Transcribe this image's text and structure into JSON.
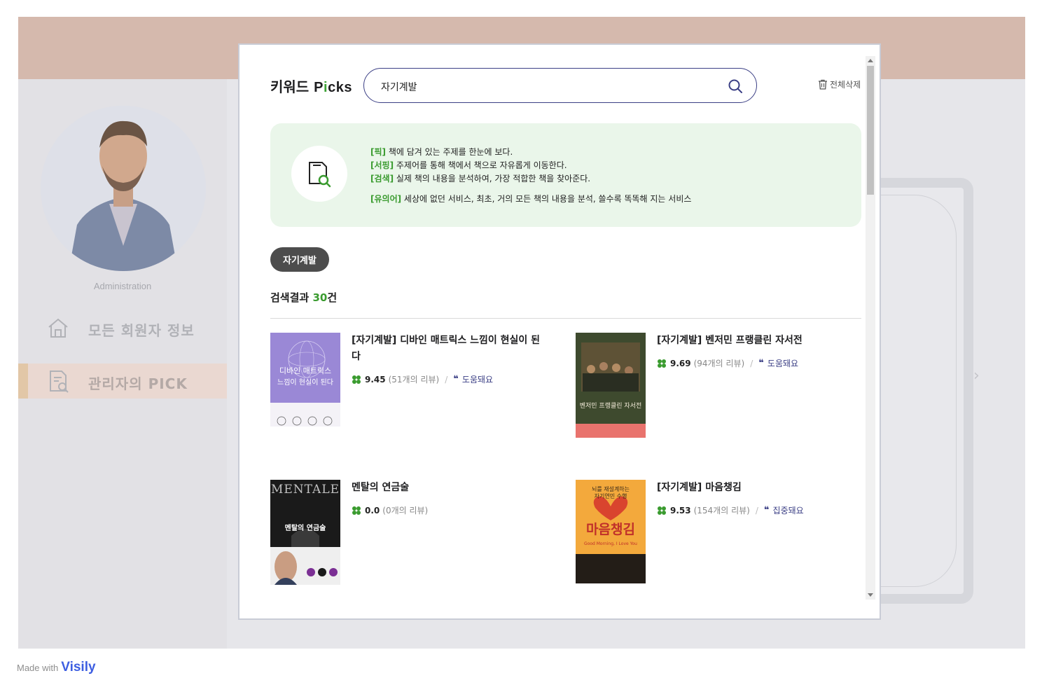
{
  "sidebar": {
    "admin_label": "Administration",
    "items": [
      {
        "label": "모든 회원자 정보",
        "icon": "home-icon"
      },
      {
        "label": "관리자의 PICK",
        "icon": "document-search-icon"
      }
    ]
  },
  "modal": {
    "logo": {
      "prefix": "키워드",
      "brand_p": "P",
      "brand_i": "i",
      "brand_rest": "cks"
    },
    "search": {
      "value": "자기계발",
      "icon": "search-icon"
    },
    "clear_all": "전체삭제",
    "info": {
      "lines": [
        {
          "tag": "[픽]",
          "text": " 책에 담겨 있는 주제를 한눈에 보다."
        },
        {
          "tag": "[서핑]",
          "text": " 주제어를 통해 책에서 책으로 자유롭게 이동한다."
        },
        {
          "tag": "[검색]",
          "text": " 실제 책의 내용을 분석하여, 가장 적합한 책을 찾아준다."
        },
        {
          "tag": "[유의어]",
          "text": " 세상에 없던 서비스, 최초, 거의 모든 책의 내용을 분석, 쓸수록 똑똑해 지는 서비스"
        }
      ]
    },
    "chip": "자기계발",
    "results": {
      "prefix": "검색결과 ",
      "count": "30",
      "suffix": "건"
    },
    "books": [
      {
        "title": "[자기계발] 디바인 매트릭스 느낌이 현실이 된다",
        "score": "9.45",
        "reviews": "(51개의 리뷰)",
        "tag": "도움돼요",
        "cover": {
          "line1": "디바인 매트릭스",
          "line2": "느낌이 현실이 된다"
        }
      },
      {
        "title": "[자기계발] 벤저민 프랭클린 자서전",
        "score": "9.69",
        "reviews": "(94개의 리뷰)",
        "tag": "도움돼요",
        "cover": {
          "line1": "벤저민 프랭클린 자서전"
        }
      },
      {
        "title": "멘탈의 연금술",
        "score": "0.0",
        "reviews": "(0개의 리뷰)",
        "tag": "",
        "cover": {
          "line0": "MENTALE",
          "line1": "멘탈의 연금술"
        }
      },
      {
        "title": "[자기계발] 마음챙김",
        "score": "9.53",
        "reviews": "(154개의 리뷰)",
        "tag": "집중돼요",
        "cover": {
          "line0": "뇌를 재설계하는",
          "line0b": "자기연민 수행",
          "line1": "마음챙김",
          "line2": "Good Morning, I Love You"
        }
      }
    ],
    "colors": {
      "accent_green": "#3a9b2f",
      "accent_navy": "#3b3f85"
    }
  },
  "footer": {
    "made_with": "Made with",
    "brand": "Visily"
  }
}
